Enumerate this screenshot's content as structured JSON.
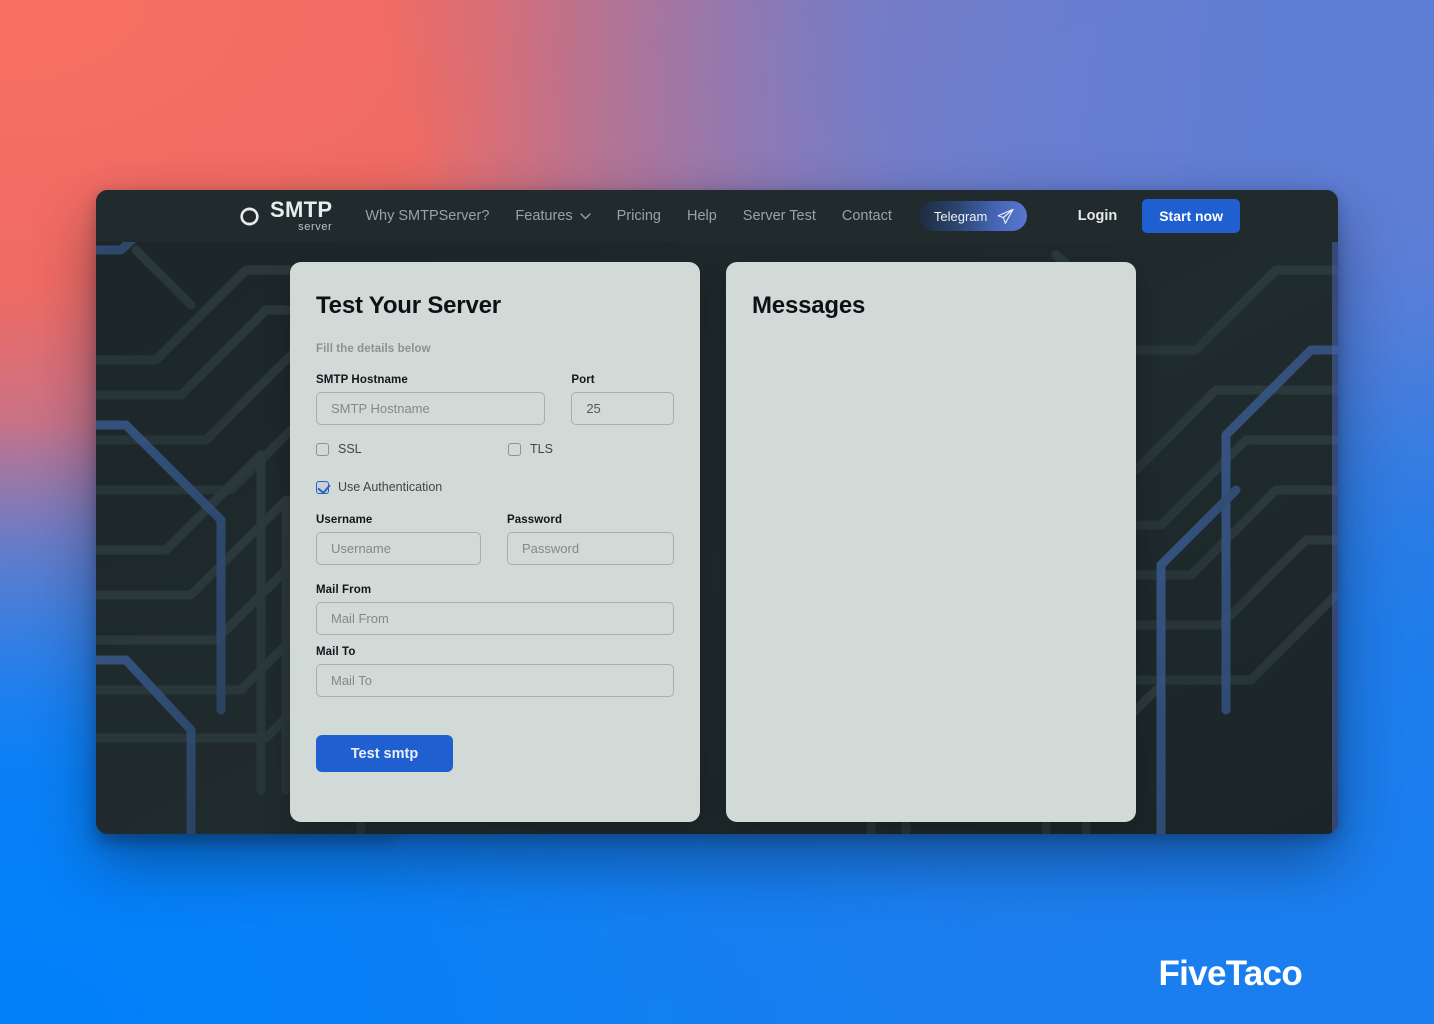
{
  "brand": {
    "logo_main": "SMTP",
    "logo_sub": "server",
    "logo_icon": "interlocking-circles-icon"
  },
  "navbar": {
    "links": [
      {
        "label": "Why SMTPServer?",
        "has_chevron": false
      },
      {
        "label": "Features",
        "has_chevron": true,
        "icon": "chevron-down-icon"
      },
      {
        "label": "Pricing",
        "has_chevron": false
      },
      {
        "label": "Help",
        "has_chevron": false
      },
      {
        "label": "Server Test",
        "has_chevron": false
      },
      {
        "label": "Contact",
        "has_chevron": false
      }
    ],
    "telegram": {
      "label": "Telegram",
      "icon": "paper-plane-icon"
    },
    "login_label": "Login",
    "start_now_label": "Start now"
  },
  "form_card": {
    "title": "Test Your Server",
    "subtitle": "Fill the details below",
    "hostname": {
      "label": "SMTP Hostname",
      "placeholder": "SMTP Hostname",
      "value": ""
    },
    "port": {
      "label": "Port",
      "placeholder": "Port",
      "value": "25"
    },
    "ssl": {
      "label": "SSL",
      "checked": false
    },
    "tls": {
      "label": "TLS",
      "checked": false
    },
    "use_auth": {
      "label": "Use Authentication",
      "checked": true
    },
    "username": {
      "label": "Username",
      "placeholder": "Username",
      "value": ""
    },
    "password": {
      "label": "Password",
      "placeholder": "Password",
      "value": ""
    },
    "mail_from": {
      "label": "Mail From",
      "placeholder": "Mail From",
      "value": ""
    },
    "mail_to": {
      "label": "Mail To",
      "placeholder": "Mail To",
      "value": ""
    },
    "submit_label": "Test smtp"
  },
  "messages_card": {
    "title": "Messages",
    "body": ""
  },
  "watermark": {
    "text": "FiveTaco"
  },
  "colors": {
    "accent_blue": "#1f5fd0",
    "panel_dark": "#1f292b",
    "card_bg": "#d2dad8",
    "backdrop_coral": "#ef6b63",
    "backdrop_periwinkle": "#5d7ed6",
    "backdrop_blue": "#0080fb",
    "watermark_white": "#ffffff"
  }
}
